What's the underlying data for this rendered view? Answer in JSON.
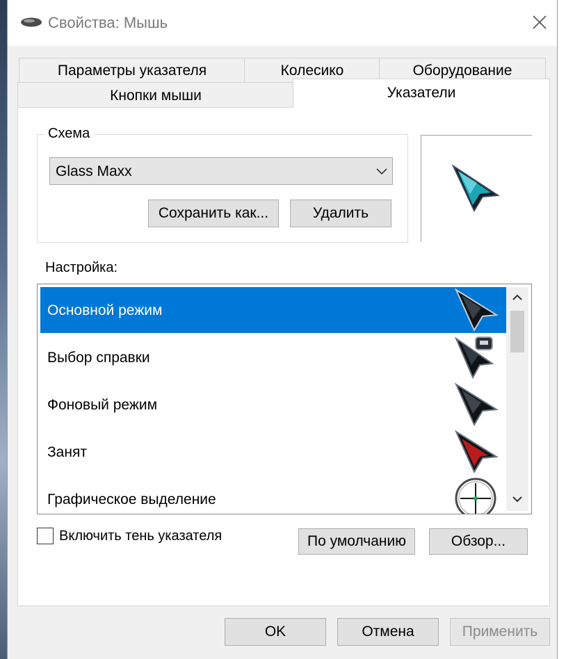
{
  "window": {
    "title": "Свойства: Мышь"
  },
  "tabs_row1": [
    {
      "label": "Параметры указателя"
    },
    {
      "label": "Колесико"
    },
    {
      "label": "Оборудование"
    }
  ],
  "tabs_row2": [
    {
      "label": "Кнопки мыши"
    },
    {
      "label": "Указатели",
      "active": true
    }
  ],
  "scheme": {
    "label": "Схема",
    "selected": "Glass Maxx",
    "save_as_label": "Сохранить как...",
    "delete_label": "Удалить"
  },
  "customize": {
    "label": "Настройка:",
    "items": [
      {
        "label": "Основной режим",
        "icon": "arrow-cursor-icon",
        "selected": true
      },
      {
        "label": "Выбор справки",
        "icon": "help-cursor-icon"
      },
      {
        "label": "Фоновый режим",
        "icon": "working-cursor-icon"
      },
      {
        "label": "Занят",
        "icon": "busy-cursor-icon"
      },
      {
        "label": "Графическое выделение",
        "icon": "precision-cursor-icon"
      }
    ]
  },
  "shadow": {
    "label": "Включить тень указателя",
    "checked": false
  },
  "buttons": {
    "default_label": "По умолчанию",
    "browse_label": "Обзор...",
    "ok_label": "OK",
    "cancel_label": "Отмена",
    "apply_label": "Применить"
  },
  "colors": {
    "selection": "#0078d7",
    "preview_cursor": "#1fb5c4",
    "busy_cursor": "#b81c1c"
  }
}
